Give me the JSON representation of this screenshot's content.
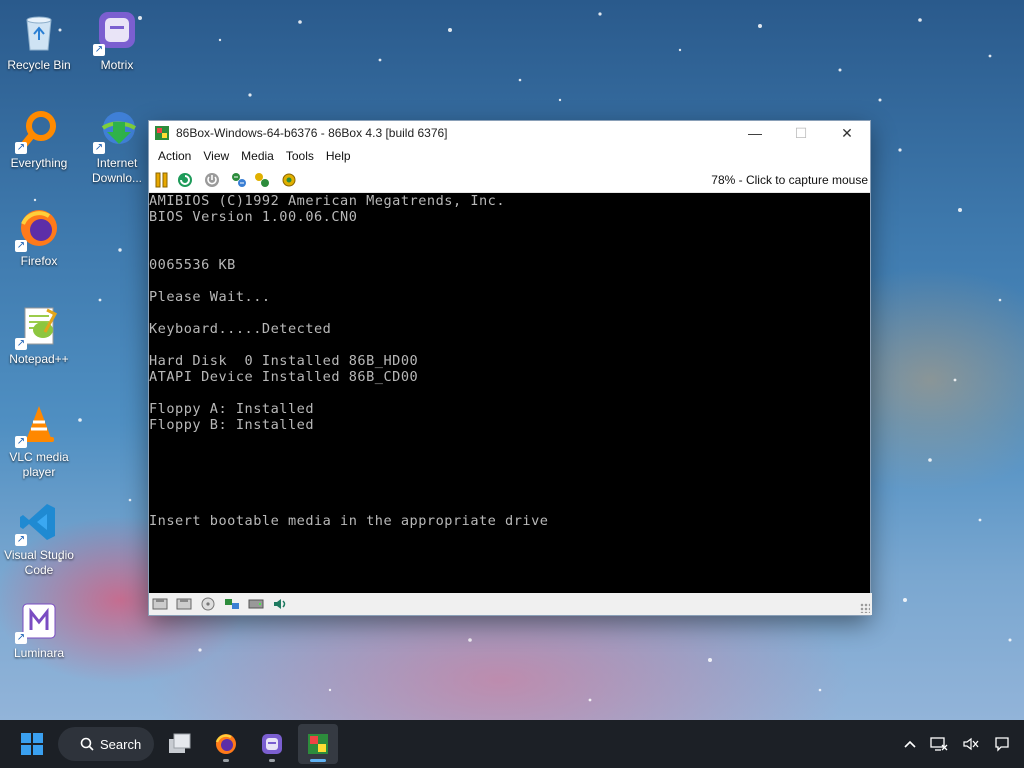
{
  "desktop": {
    "icons": [
      {
        "label": "Recycle Bin",
        "icon": "recycle-bin-icon"
      },
      {
        "label": "Motrix",
        "icon": "motrix-icon"
      },
      {
        "label": "Everything",
        "icon": "everything-icon"
      },
      {
        "label": "Internet Downlo...",
        "icon": "idm-icon"
      },
      {
        "label": "Firefox",
        "icon": "firefox-icon"
      },
      {
        "label": "Notepad++",
        "icon": "notepadpp-icon"
      },
      {
        "label": "VLC media player",
        "icon": "vlc-icon"
      },
      {
        "label": "Visual Studio Code",
        "icon": "vscode-icon"
      },
      {
        "label": "Luminara",
        "icon": "luminara-icon"
      }
    ]
  },
  "window": {
    "title": "86Box-Windows-64-b6376 - 86Box 4.3 [build 6376]",
    "controls": {
      "minimize": "—",
      "maximize": "☐",
      "close": "✕"
    },
    "menu": [
      "Action",
      "View",
      "Media",
      "Tools",
      "Help"
    ],
    "toolbar_status": "78% - Click to capture mouse",
    "bios_lines": [
      "AMIBIOS (C)1992 American Megatrends, Inc.",
      "BIOS Version 1.00.06.CN0",
      "",
      "",
      "0065536 KB",
      "",
      "Please Wait...",
      "",
      "Keyboard.....Detected",
      "",
      "Hard Disk  0 Installed 86B_HD00",
      "ATAPI Device Installed 86B_CD00",
      "",
      "Floppy A: Installed",
      "Floppy B: Installed",
      "",
      "",
      "",
      "",
      "",
      "Insert bootable media in the appropriate drive"
    ]
  },
  "taskbar": {
    "search_label": "Search",
    "apps": [
      "task-view-icon",
      "firefox-icon",
      "motrix-icon",
      "86box-icon"
    ]
  },
  "colors": {
    "bios_text": "#b8b8b8",
    "taskbar_bg": "#1c2026"
  }
}
